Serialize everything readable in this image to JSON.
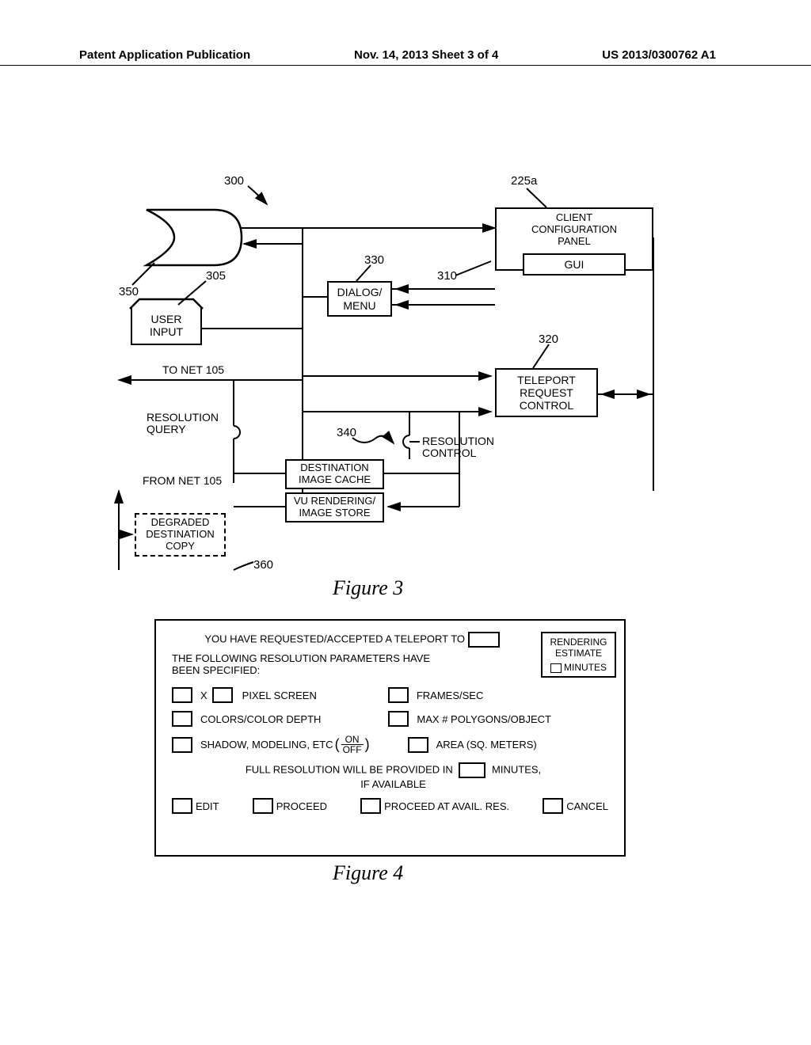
{
  "header": {
    "left": "Patent Application Publication",
    "center": "Nov. 14, 2013  Sheet 3 of 4",
    "right": "US 2013/0300762 A1"
  },
  "fig3": {
    "caption": "Figure 3",
    "refs": {
      "r300": "300",
      "r225a": "225a",
      "r350": "350",
      "r305": "305",
      "r330": "330",
      "r310": "310",
      "r320": "320",
      "r340": "340",
      "r360": "360"
    },
    "boxes": {
      "client_panel": "CLIENT\nCONFIGURATION\nPANEL",
      "gui": "GUI",
      "dialog_menu": "DIALOG/\nMENU",
      "user_input": "USER\nINPUT",
      "teleport": "TELEPORT\nREQUEST\nCONTROL",
      "dest_cache": "DESTINATION\nIMAGE CACHE",
      "vu_render": "VU RENDERING/\nIMAGE STORE",
      "degraded": "DEGRADED\nDESTINATION\nCOPY"
    },
    "labels": {
      "to_net": "TO NET 105",
      "from_net": "FROM NET 105",
      "res_query": "RESOLUTION\nQUERY",
      "res_control": "RESOLUTION\nCONTROL"
    }
  },
  "fig4": {
    "caption": "Figure 4",
    "title_line": "YOU HAVE REQUESTED/ACCEPTED A TELEPORT TO",
    "subtitle": "THE FOLLOWING RESOLUTION PARAMETERS HAVE BEEN SPECIFIED:",
    "rendering_estimate": "RENDERING ESTIMATE",
    "minutes_chk": "MINUTES",
    "row1": {
      "x": "X",
      "pixel": "PIXEL SCREEN",
      "fps": "FRAMES/SEC"
    },
    "row2": {
      "colors": "COLORS/COLOR DEPTH",
      "polys": "MAX # POLYGONS/OBJECT"
    },
    "row3": {
      "shadow_pre": "SHADOW, MODELING, ETC",
      "on": "ON",
      "off": "OFF",
      "area": "AREA (SQ. METERS)"
    },
    "full_res_pre": "FULL RESOLUTION WILL BE PROVIDED IN",
    "full_res_post": "MINUTES,",
    "if_avail": "IF AVAILABLE",
    "buttons": {
      "edit": "EDIT",
      "proceed": "PROCEED",
      "proceed_avail": "PROCEED AT AVAIL. RES.",
      "cancel": "CANCEL"
    }
  }
}
